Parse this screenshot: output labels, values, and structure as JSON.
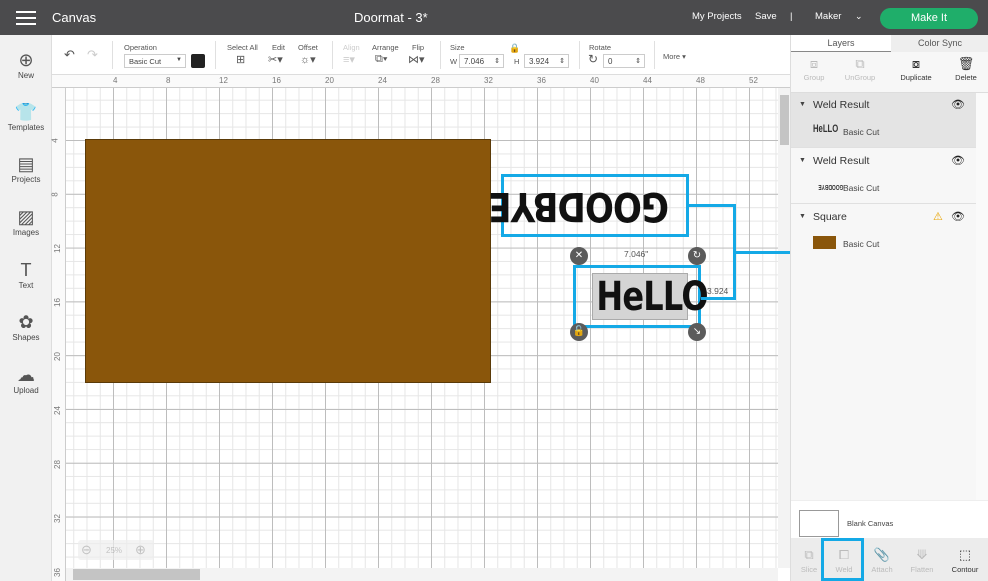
{
  "topbar": {
    "app": "Canvas",
    "title": "Doormat - 3*",
    "my_projects": "My Projects",
    "save": "Save",
    "divider": "|",
    "machine": "Maker",
    "make_it": "Make It",
    "accent": "#1fae6a"
  },
  "sidebar": {
    "items": [
      {
        "label": "New",
        "icon": "plus-circle-icon"
      },
      {
        "label": "Templates",
        "icon": "shirt-icon"
      },
      {
        "label": "Projects",
        "icon": "projects-icon"
      },
      {
        "label": "Images",
        "icon": "image-icon"
      },
      {
        "label": "Text",
        "icon": "text-icon"
      },
      {
        "label": "Shapes",
        "icon": "shapes-icon"
      },
      {
        "label": "Upload",
        "icon": "upload-icon"
      }
    ]
  },
  "toolbar": {
    "operation_label": "Operation",
    "operation_value": "Basic Cut",
    "select_all": "Select All",
    "edit": "Edit",
    "offset": "Offset",
    "align": "Align",
    "arrange": "Arrange",
    "flip": "Flip",
    "size": "Size",
    "w_label": "W",
    "w": "7.046",
    "h_label": "H",
    "h": "3.924",
    "rotate": "Rotate",
    "rotate_value": "0",
    "more": "More ▾"
  },
  "ruler": {
    "top": [
      "4",
      "8",
      "12",
      "16",
      "20",
      "24",
      "28",
      "32",
      "36",
      "40",
      "44",
      "48",
      "52"
    ],
    "left": [
      "4",
      "8",
      "12",
      "16",
      "20",
      "24",
      "28",
      "32",
      "36"
    ]
  },
  "canvas": {
    "goodbye_text": "GOODBYE",
    "hello_text": "HeLLO",
    "width_label": "7.046\"",
    "height_label": "3.924",
    "zoom": "25%",
    "rect_color": "#8a560b",
    "selection_color": "#14a9e6"
  },
  "panel": {
    "tabs": [
      "Layers",
      "Color Sync"
    ],
    "tools": [
      "Group",
      "UnGroup",
      "Duplicate",
      "Delete"
    ],
    "layers": [
      {
        "name": "Weld Result",
        "thumb": "HeLLO",
        "op": "Basic Cut"
      },
      {
        "name": "Weld Result",
        "thumb": "GOODBYE",
        "op": "Basic Cut"
      },
      {
        "name": "Square",
        "op": "Basic Cut",
        "warning": true
      }
    ],
    "blank_canvas": "Blank Canvas",
    "bottom_tools": [
      "Slice",
      "Weld",
      "Attach",
      "Flatten",
      "Contour"
    ]
  }
}
